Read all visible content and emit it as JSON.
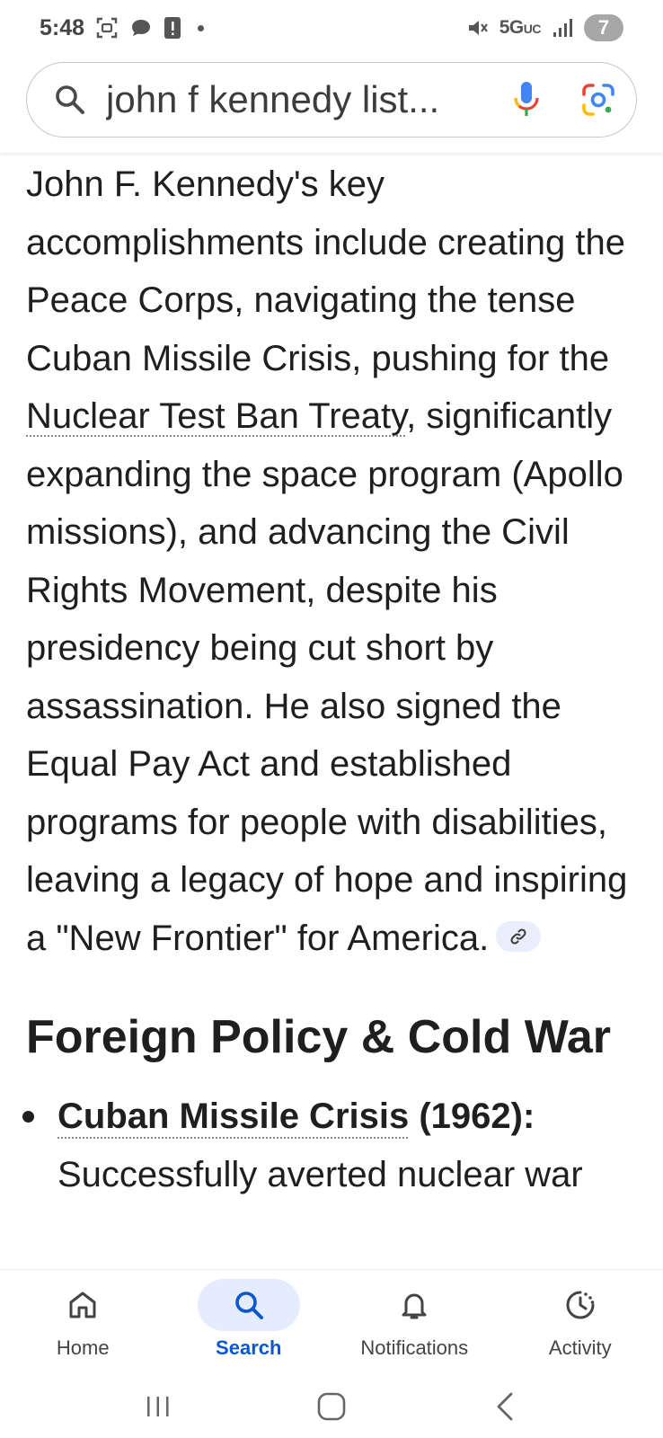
{
  "status_bar": {
    "time": "5:48",
    "network": "5G",
    "network_sub": "UC",
    "battery": "7"
  },
  "search": {
    "query": "john f kennedy list..."
  },
  "answer": {
    "part1": "John F. Kennedy's key accomplishments include creating the Peace Corps, navigating the tense Cuban Missile Crisis, pushing for the ",
    "link1": "Nuclear Test Ban Treaty",
    "part2": ", significantly expanding the space program (Apollo missions), and advancing the Civil Rights Movement, despite his presidency being cut short by assassination. He also signed the Equal Pay Act and established programs for people with disabilities, leaving a legacy of hope and inspiring a \"New Frontier\" for America."
  },
  "section": {
    "heading": "Foreign Policy & Cold War",
    "bullets": [
      {
        "term": "Cuban Missile Crisis",
        "suffix": " (1962):",
        "text": " Successfully averted nuclear war"
      }
    ]
  },
  "bottom_nav": [
    {
      "label": "Home",
      "icon": "home-icon"
    },
    {
      "label": "Search",
      "icon": "search-icon"
    },
    {
      "label": "Notifications",
      "icon": "bell-icon"
    },
    {
      "label": "Activity",
      "icon": "activity-icon"
    }
  ],
  "colors": {
    "accent": "#0b57d0",
    "active_nav_bg": "#e5ecfd",
    "text": "#1f1f1f"
  }
}
